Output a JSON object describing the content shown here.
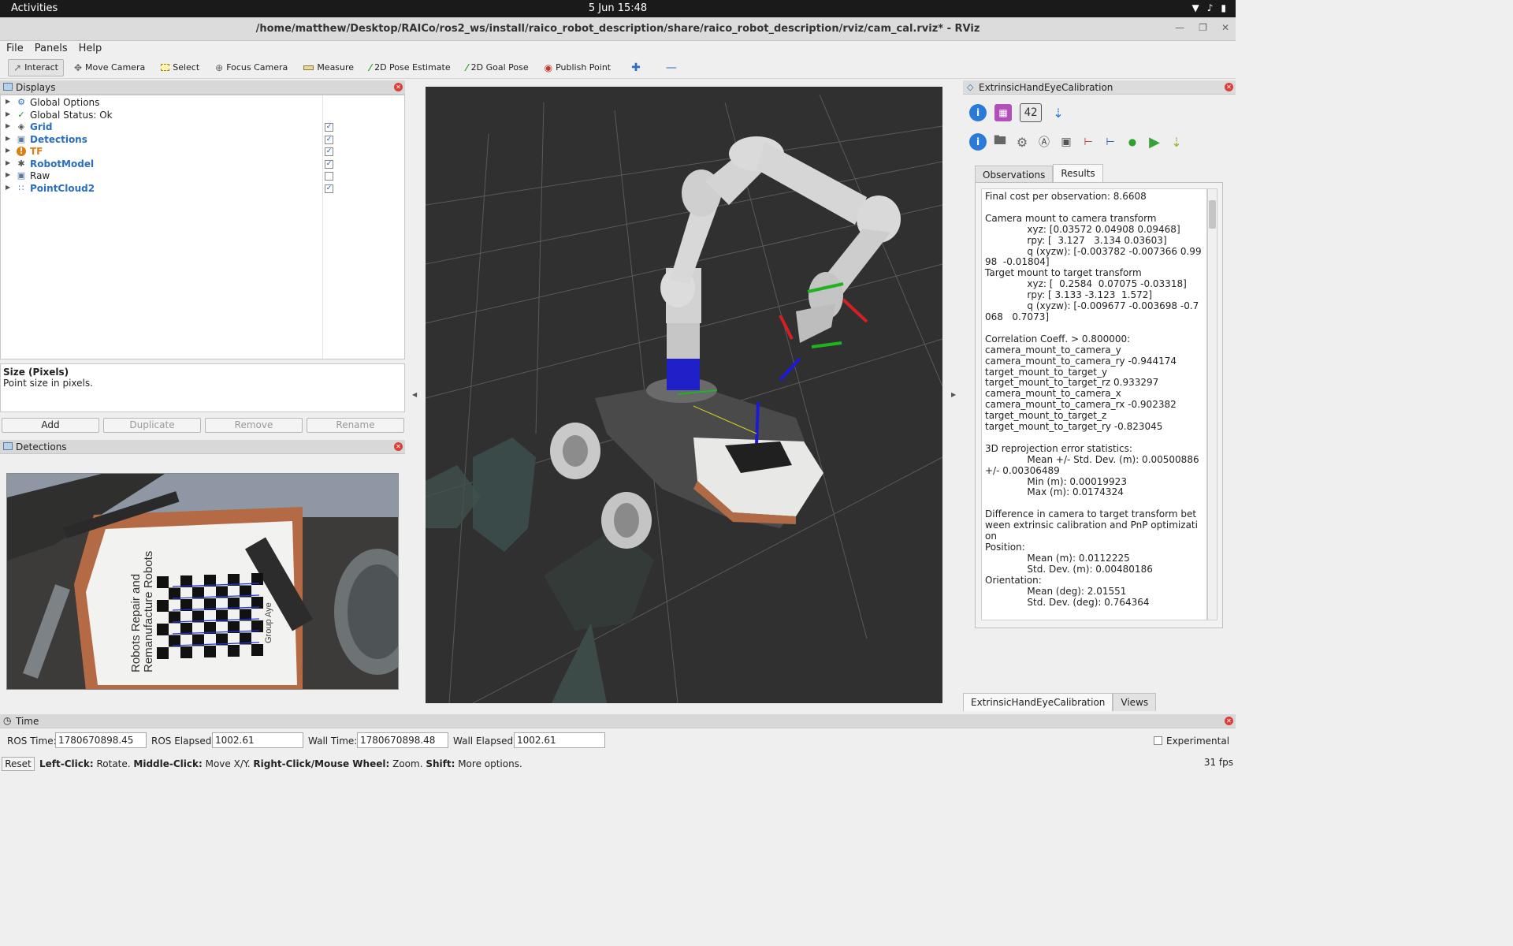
{
  "system_bar": {
    "activities": "Activities",
    "clock": "5 Jun  15:48"
  },
  "window": {
    "title": "/home/matthew/Desktop/RAICo/ros2_ws/install/raico_robot_description/share/raico_robot_description/rviz/cam_cal.rviz* - RViz"
  },
  "menu": [
    "File",
    "Panels",
    "Help"
  ],
  "toolbar": {
    "tools": [
      "Interact",
      "Move Camera",
      "Select",
      "Focus Camera",
      "Measure",
      "2D Pose Estimate",
      "2D Goal Pose",
      "Publish Point"
    ]
  },
  "displays_panel": {
    "title": "Displays",
    "items": [
      {
        "label": "Global Options",
        "style": "plain",
        "checkbox": null
      },
      {
        "label": "Global Status: Ok",
        "style": "plain",
        "checkbox": null
      },
      {
        "label": "Grid",
        "style": "link",
        "checkbox": true
      },
      {
        "label": "Detections",
        "style": "link",
        "checkbox": true
      },
      {
        "label": "TF",
        "style": "warn",
        "checkbox": true
      },
      {
        "label": "RobotModel",
        "style": "link",
        "checkbox": true
      },
      {
        "label": "Raw",
        "style": "plain",
        "checkbox": false
      },
      {
        "label": "PointCloud2",
        "style": "link",
        "checkbox": true
      }
    ],
    "description_title": "Size (Pixels)",
    "description_text": "Point size in pixels.",
    "buttons": [
      "Add",
      "Duplicate",
      "Remove",
      "Rename"
    ]
  },
  "detections_panel": {
    "title": "Detections",
    "image_text": [
      "Robots Repair and",
      "Remanufacture Robots",
      "Group Aye"
    ]
  },
  "calibration_panel": {
    "title": "ExtrinsicHandEyeCalibration",
    "tool_number": "42",
    "tabs": [
      "Observations",
      "Results"
    ],
    "results": "Final cost per observation: 8.6608\n\nCamera mount to camera transform\n              xyz: [0.03572 0.04908 0.09468]\n              rpy: [  3.127   3.134 0.03603]\n              q (xyzw): [-0.003782 -0.007366 0.9998  -0.01804]\nTarget mount to target transform\n              xyz: [  0.2584  0.07075 -0.03318]\n              rpy: [ 3.133 -3.123  1.572]\n              q (xyzw): [-0.009677 -0.003698 -0.7068   0.7073]\n\nCorrelation Coeff. > 0.800000:\ncamera_mount_to_camera_y\ncamera_mount_to_camera_ry -0.944174\ntarget_mount_to_target_y\ntarget_mount_to_target_rz 0.933297\ncamera_mount_to_camera_x\ncamera_mount_to_camera_rx -0.902382\ntarget_mount_to_target_z\ntarget_mount_to_target_ry -0.823045\n\n3D reprojection error statistics:\n              Mean +/- Std. Dev. (m): 0.00500886 +/- 0.00306489\n              Min (m): 0.00019923\n              Max (m): 0.0174324\n\nDifference in camera to target transform between extrinsic calibration and PnP optimization\nPosition:\n              Mean (m): 0.0112225\n              Std. Dev. (m): 0.00480186\nOrientation:\n              Mean (deg): 2.01551\n              Std. Dev. (deg): 0.764364",
    "bottom_tabs": [
      "ExtrinsicHandEyeCalibration",
      "Views"
    ]
  },
  "time_panel": {
    "title": "Time",
    "ros_time_label": "ROS Time:",
    "ros_time": "1780670898.45",
    "ros_elapsed_label": "ROS Elapsed:",
    "ros_elapsed": "1002.61",
    "wall_time_label": "Wall Time:",
    "wall_time": "1780670898.48",
    "wall_elapsed_label": "Wall Elapsed:",
    "wall_elapsed": "1002.61",
    "experimental_label": "Experimental"
  },
  "status_bar": {
    "reset": "Reset",
    "hint_parts": [
      {
        "b": "Left-Click:",
        "t": " Rotate. "
      },
      {
        "b": "Middle-Click:",
        "t": " Move X/Y. "
      },
      {
        "b": "Right-Click/Mouse Wheel:",
        "t": " Zoom. "
      },
      {
        "b": "Shift:",
        "t": " More options."
      }
    ],
    "fps": "31 fps"
  }
}
